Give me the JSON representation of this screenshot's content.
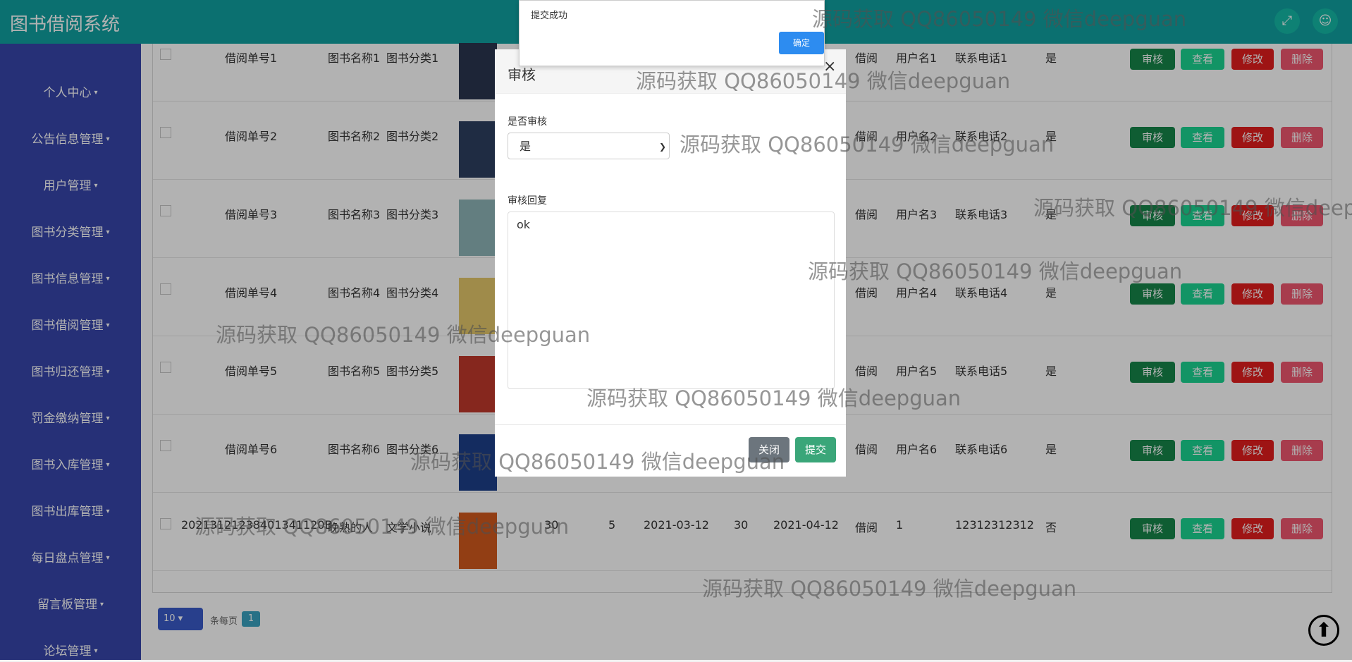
{
  "header": {
    "title": "图书借阅系统",
    "fullscreen_icon": "expand-icon",
    "user_icon": "user-icon"
  },
  "sidebar": {
    "items": [
      {
        "label": "个人中心"
      },
      {
        "label": "公告信息管理"
      },
      {
        "label": "用户管理"
      },
      {
        "label": "图书分类管理"
      },
      {
        "label": "图书信息管理"
      },
      {
        "label": "图书借阅管理"
      },
      {
        "label": "图书归还管理"
      },
      {
        "label": "罚金缴纳管理"
      },
      {
        "label": "图书入库管理"
      },
      {
        "label": "图书出库管理"
      },
      {
        "label": "每日盘点管理"
      },
      {
        "label": "留言板管理"
      },
      {
        "label": "论坛管理"
      }
    ]
  },
  "table": {
    "buttons": {
      "audit": "审核",
      "view": "查看",
      "edit": "修改",
      "delete": "删除"
    },
    "rows": [
      {
        "no": "借阅单号1",
        "name": "图书名称1",
        "category": "图书分类1",
        "qty": "",
        "days": "",
        "borrow_date": "",
        "amount": "",
        "return_date": "",
        "status": "借阅",
        "user": "用户名1",
        "phone": "联系电话1",
        "audited": "是",
        "cover": "#2a3550"
      },
      {
        "no": "借阅单号2",
        "name": "图书名称2",
        "category": "图书分类2",
        "qty": "",
        "days": "",
        "borrow_date": "",
        "amount": "",
        "return_date": "",
        "status": "借阅",
        "user": "用户名2",
        "phone": "联系电话2",
        "audited": "是",
        "cover": "#2d3f60"
      },
      {
        "no": "借阅单号3",
        "name": "图书名称3",
        "category": "图书分类3",
        "qty": "",
        "days": "",
        "borrow_date": "",
        "amount": "",
        "return_date": "",
        "status": "借阅",
        "user": "用户名3",
        "phone": "联系电话3",
        "audited": "是",
        "cover": "#8fb5b8"
      },
      {
        "no": "借阅单号4",
        "name": "图书名称4",
        "category": "图书分类4",
        "qty": "",
        "days": "",
        "borrow_date": "",
        "amount": "",
        "return_date": "",
        "status": "借阅",
        "user": "用户名4",
        "phone": "联系电话4",
        "audited": "是",
        "cover": "#e4c76a"
      },
      {
        "no": "借阅单号5",
        "name": "图书名称5",
        "category": "图书分类5",
        "qty": "",
        "days": "",
        "borrow_date": "",
        "amount": "",
        "return_date": "",
        "status": "借阅",
        "user": "用户名5",
        "phone": "联系电话5",
        "audited": "是",
        "cover": "#c1392b"
      },
      {
        "no": "借阅单号6",
        "name": "图书名称6",
        "category": "图书分类6",
        "qty": "",
        "days": "",
        "borrow_date": "",
        "amount": "",
        "return_date": "",
        "status": "借阅",
        "user": "用户名6",
        "phone": "联系电话6",
        "audited": "是",
        "cover": "#1d3f8a"
      },
      {
        "no": "20213121238401341120B",
        "name": "晚熟的人",
        "category": "文学小说",
        "qty": "30",
        "days": "5",
        "borrow_date": "2021-03-12",
        "amount": "30",
        "return_date": "2021-04-12",
        "status": "借阅",
        "user": "1",
        "phone": "12312312312",
        "audited": "否",
        "cover": "#d25a1e"
      }
    ]
  },
  "pager": {
    "size": "10",
    "per_page_label": "条每页",
    "page": "1"
  },
  "scrolltop": {
    "icon": "arrow-up-icon"
  },
  "modal": {
    "title": "审核",
    "close": "×",
    "audit_label": "是否审核",
    "audit_value": "是",
    "reply_label": "审核回复",
    "reply_value": "ok",
    "close_btn": "关闭",
    "submit_btn": "提交"
  },
  "alert": {
    "message": "提交成功",
    "ok": "确定"
  },
  "watermark": "源码获取 QQ86050149 微信deepguan"
}
